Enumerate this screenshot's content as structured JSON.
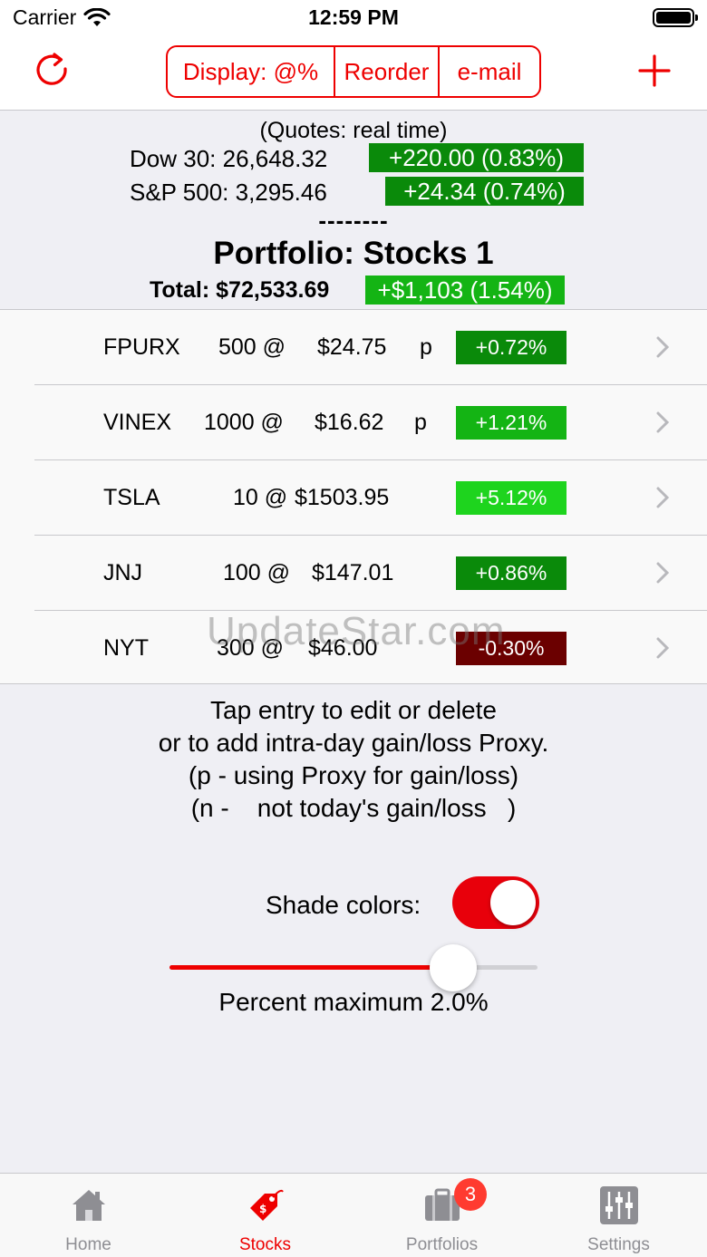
{
  "status_bar": {
    "carrier": "Carrier",
    "time": "12:59 PM"
  },
  "nav": {
    "segments": [
      "Display: @%",
      "Reorder",
      "e-mail"
    ],
    "accent_color": "#e00000"
  },
  "summary": {
    "quotes_label": "(Quotes: real time)",
    "indices": [
      {
        "name": "Dow 30: 26,648.32",
        "change": "+220.00 (0.83%)"
      },
      {
        "name": "S&P 500: 3,295.46",
        "change": "+24.34 (0.74%)"
      }
    ],
    "separator": "--------",
    "portfolio_title": "Portfolio: Stocks 1",
    "total": "Total: $72,533.69",
    "total_change": "+$1,103 (1.54%)"
  },
  "holdings": [
    {
      "symbol": "FPURX",
      "qty": "500 @",
      "price": "$24.75",
      "proxy": "p",
      "pct": "+0.72%",
      "color": "#0a8a0a"
    },
    {
      "symbol": "VINEX",
      "qty": "1000 @",
      "price": "$16.62",
      "proxy": "p",
      "pct": "+1.21%",
      "color": "#14b414"
    },
    {
      "symbol": "TSLA",
      "qty": "10 @",
      "price": "$1503.95",
      "proxy": "",
      "pct": "+5.12%",
      "color": "#1ed41e"
    },
    {
      "symbol": "JNJ",
      "qty": "100 @",
      "price": "$147.01",
      "proxy": "",
      "pct": "+0.86%",
      "color": "#0a8a0a"
    },
    {
      "symbol": "NYT",
      "qty": "300 @",
      "price": "$46.00",
      "proxy": "",
      "pct": "-0.30%",
      "color": "#6b0000"
    }
  ],
  "watermark": "UpdateStar.com",
  "info_lines": [
    "Tap entry to edit or delete",
    "or to add intra-day gain/loss Proxy.",
    "(p - using Proxy for gain/loss)",
    "(n -    not today's gain/loss   )"
  ],
  "shade": {
    "label": "Shade colors:",
    "on": true
  },
  "slider": {
    "value_fraction": 0.77,
    "label": "Percent maximum 2.0%"
  },
  "tabs": [
    {
      "label": "Home",
      "icon": "home-icon"
    },
    {
      "label": "Stocks",
      "icon": "price-tag-icon",
      "active": true
    },
    {
      "label": "Portfolios",
      "icon": "briefcase-icon",
      "badge": "3"
    },
    {
      "label": "Settings",
      "icon": "sliders-icon"
    }
  ]
}
